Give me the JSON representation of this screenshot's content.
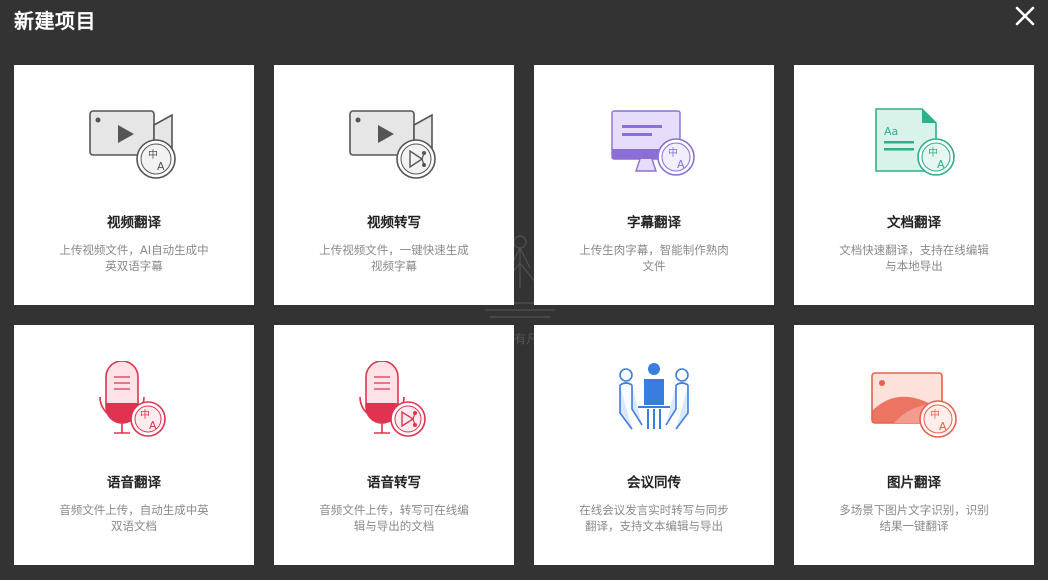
{
  "dialog": {
    "title": "新建项目",
    "close_icon": "close-icon"
  },
  "cards": [
    {
      "title": "视频翻译",
      "desc": "上传视频文件，AI自动生成中英双语字幕",
      "icon": "video-translate-icon",
      "accent": "#555555"
    },
    {
      "title": "视频转写",
      "desc": "上传视频文件，一键快速生成视频字幕",
      "icon": "video-transcribe-icon",
      "accent": "#555555"
    },
    {
      "title": "字幕翻译",
      "desc": "上传生肉字幕，智能制作熟肉文件",
      "icon": "subtitle-translate-icon",
      "accent": "#8b6fd6"
    },
    {
      "title": "文档翻译",
      "desc": "文档快速翻译，支持在线编辑与本地导出",
      "icon": "document-translate-icon",
      "accent": "#2fb08a"
    },
    {
      "title": "语音翻译",
      "desc": "音频文件上传，自动生成中英双语文档",
      "icon": "audio-translate-icon",
      "accent": "#e0334f"
    },
    {
      "title": "语音转写",
      "desc": "音频文件上传，转写可在线编辑与导出的文档",
      "icon": "audio-transcribe-icon",
      "accent": "#e0334f"
    },
    {
      "title": "会议同传",
      "desc": "在线会议发言实时转写与同步翻译，支持文本编辑与导出",
      "icon": "meeting-interpret-icon",
      "accent": "#3a7de0"
    },
    {
      "title": "图片翻译",
      "desc": "多场景下图片文字识别，识别结果一键翻译",
      "icon": "image-translate-icon",
      "accent": "#e8604c"
    }
  ],
  "watermark_text": "有凡"
}
